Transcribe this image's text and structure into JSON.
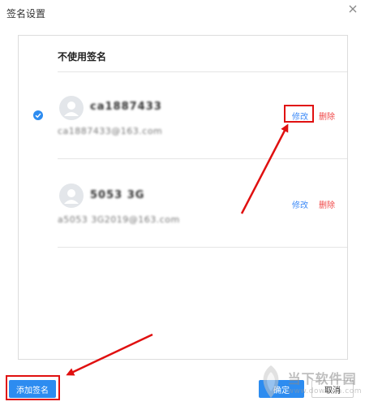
{
  "dialog": {
    "title": "签名设置",
    "close_icon": "close-icon"
  },
  "panel": {
    "header": "不使用签名"
  },
  "signatures": [
    {
      "selected": true,
      "name": "ca1887433",
      "email": "ca1887433@163.com",
      "edit_label": "修改",
      "delete_label": "删除"
    },
    {
      "selected": false,
      "name": "5053 3G",
      "email": "a5053 3G2019@163.com",
      "edit_label": "修改",
      "delete_label": "删除"
    }
  ],
  "footer": {
    "add_label": "添加签名",
    "ok_label": "确定",
    "cancel_label": "取消"
  },
  "watermark": {
    "cn": "当下软件园",
    "en": "www.downxia.com"
  },
  "colors": {
    "accent": "#2d8cf0",
    "edit_link": "#3d8af7",
    "delete_link": "#f04848",
    "annotation": "#e01010"
  }
}
